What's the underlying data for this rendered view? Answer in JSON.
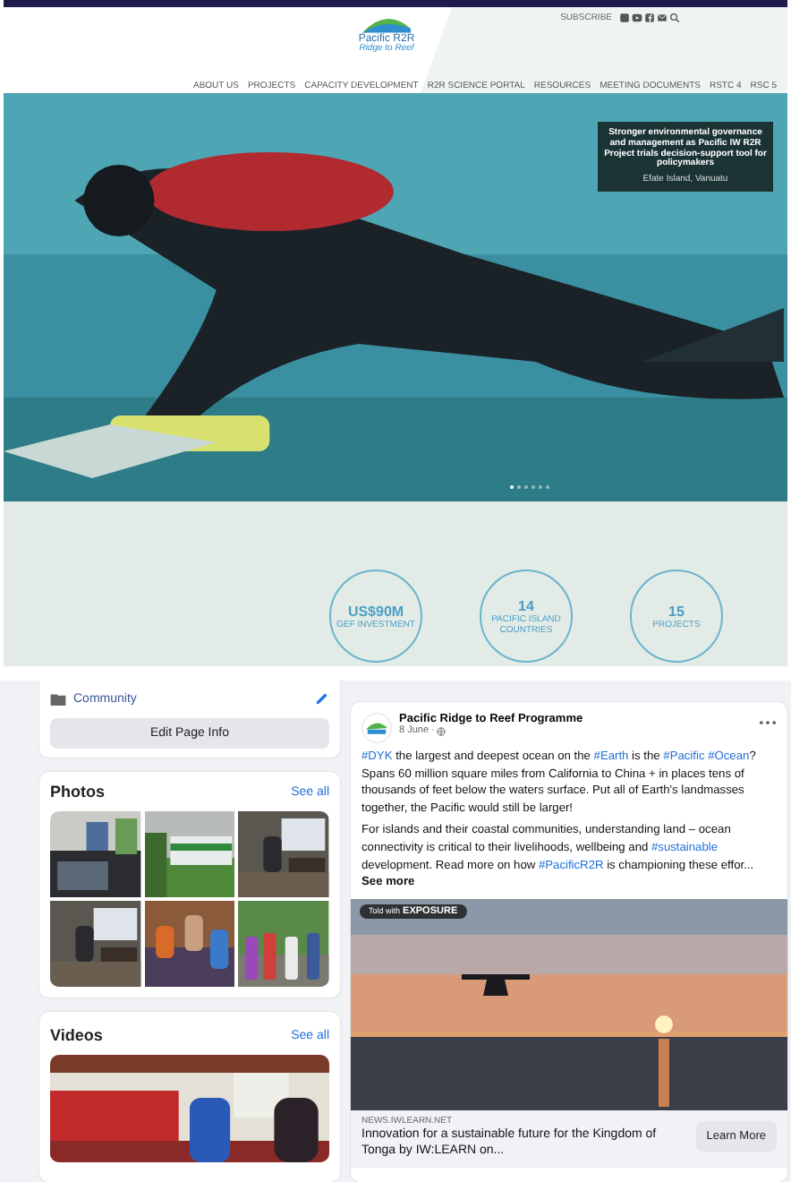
{
  "website": {
    "logo": {
      "title": "Pacific R2R",
      "subtitle": "Ridge to Reef"
    },
    "subscribe": "SUBSCRIBE",
    "nav": [
      "ABOUT US",
      "PROJECTS",
      "CAPACITY DEVELOPMENT",
      "R2R SCIENCE PORTAL",
      "RESOURCES",
      "MEETING DOCUMENTS",
      "RSTC 4",
      "RSC 5"
    ],
    "hero": {
      "kind": "picture",
      "headline": "Stronger environmental governance and management as Pacific IW R2R Project trials decision-support tool for policymakers",
      "location": "Efate Island, Vanuatu",
      "slides": [
        {
          "selected": true
        },
        {
          "selected": false
        },
        {
          "selected": false
        },
        {
          "selected": false
        },
        {
          "selected": false
        },
        {
          "selected": false
        }
      ]
    },
    "stats": [
      {
        "value": "US$90M",
        "label": "GEF INVESTMENT"
      },
      {
        "value": "14",
        "label": "PACIFIC ISLAND COUNTRIES"
      },
      {
        "value": "15",
        "label": "PROJECTS"
      }
    ]
  },
  "facebook": {
    "about": {
      "category": "Community",
      "edit_button": "Edit Page Info"
    },
    "photos": {
      "title": "Photos",
      "see_all": "See all"
    },
    "videos": {
      "title": "Videos",
      "see_all": "See all"
    },
    "post": {
      "author": "Pacific Ridge to Reef Programme",
      "date": "8 June ·",
      "paragraphs": [
        [
          {
            "kind": "hashtag",
            "text": "#DYK"
          },
          {
            "kind": "text",
            "text": " the largest and deepest ocean on the "
          },
          {
            "kind": "hashtag",
            "text": "#Earth"
          },
          {
            "kind": "text",
            "text": " is the "
          },
          {
            "kind": "hashtag",
            "text": "#Pacific"
          },
          {
            "kind": "hashtag",
            "text": "#Ocean",
            "space_before": true
          },
          {
            "kind": "text",
            "text": "? Spans 60 million square miles from California to China + in places tens of thousands of feet below the waters surface. Put all of Earth's landmasses together, the Pacific would still be larger!"
          }
        ],
        [
          {
            "kind": "text",
            "text": "For islands and their coastal communities, understanding land – ocean connectivity is critical to their livelihoods, wellbeing and "
          },
          {
            "kind": "hashtag",
            "text": "#sustainable"
          },
          {
            "kind": "text",
            "text": " development. Read more on how "
          },
          {
            "kind": "hashtag",
            "text": "#PacificR2R"
          },
          {
            "kind": "text",
            "text": " is championing these effor... "
          },
          {
            "kind": "more",
            "text": "See more"
          }
        ]
      ],
      "image": {
        "kind": "picture",
        "badge_prefix": "Told with",
        "badge_brand": "EXPOSURE"
      },
      "link": {
        "domain": "NEWS.IWLEARN.NET",
        "title": "Innovation for a sustainable future for the Kingdom of Tonga by IW:LEARN on...",
        "button": "Learn More"
      }
    }
  }
}
